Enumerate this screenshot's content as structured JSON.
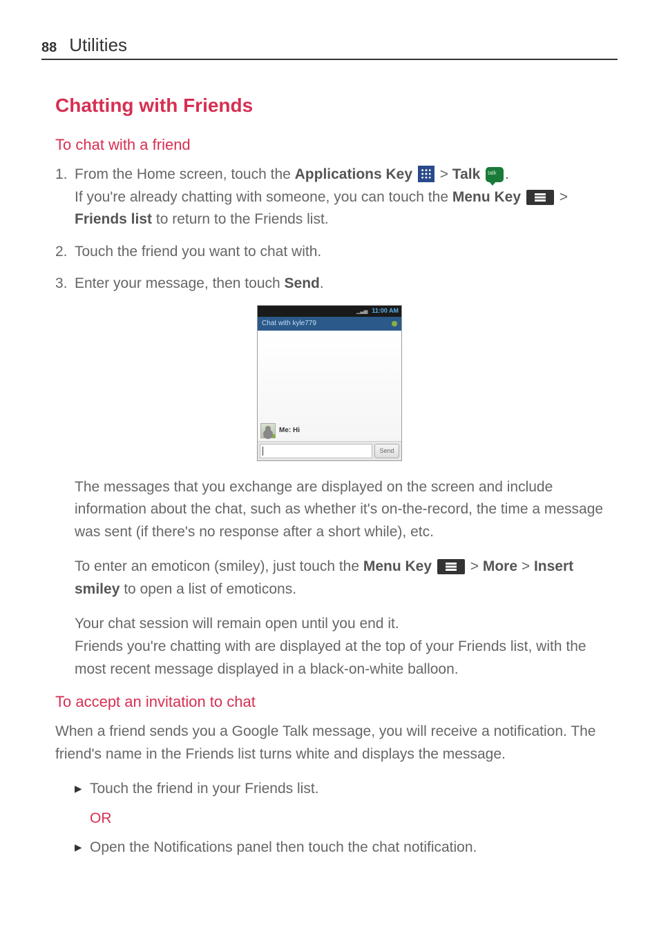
{
  "header": {
    "page_number": "88",
    "section": "Utilities"
  },
  "heading": "Chatting with Friends",
  "sub1": "To chat with a friend",
  "step1": {
    "num": "1.",
    "part1": "From the Home screen, touch the ",
    "apps_key": "Applications Key",
    "gt1": " > ",
    "talk": "Talk",
    "period": ".",
    "line2a": "If you're already chatting with someone, you can touch the ",
    "menu_key": "Menu Key",
    "gt2": " > ",
    "friends_list": "Friends list",
    "line2b": " to return to the Friends list."
  },
  "step2": {
    "num": "2.",
    "text": "Touch the friend you want to chat with."
  },
  "step3": {
    "num": "3.",
    "text_a": "Enter your message, then touch ",
    "send": "Send",
    "text_b": "."
  },
  "screenshot": {
    "time": "11:00 AM",
    "title": "Chat with kyle779",
    "msg": "Me: Hi",
    "send_btn": "Send"
  },
  "para1": "The messages that you exchange are displayed on the screen and include information about the chat, such as whether it's on-the-record, the time a message was sent (if there's no response after a short while), etc.",
  "para2": {
    "a": "To enter an emoticon (smiley), just touch the ",
    "menu_key": "Menu Key",
    "gt": " > ",
    "more": "More",
    "gt2": " > ",
    "insert": "Insert smiley",
    "b": " to open a list of emoticons."
  },
  "para3": "Your chat session will remain open until you end it.\nFriends you're chatting with are displayed at the top of your Friends list, with the most recent message displayed in a black-on-white balloon.",
  "sub2": "To accept an invitation to chat",
  "para4": "When a friend sends you a Google Talk message, you will receive a notification. The friend's name in the Friends list turns white and displays the message.",
  "bullet1": "Touch the friend in your Friends list.",
  "or": "OR",
  "bullet2": "Open the Notifications panel then touch the chat notification."
}
